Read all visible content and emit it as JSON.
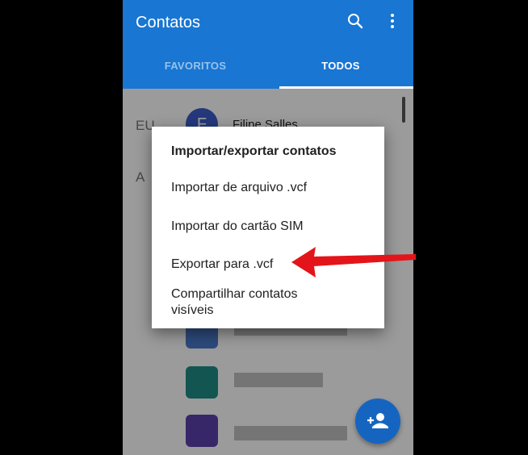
{
  "app": {
    "title": "Contatos",
    "tabs": [
      {
        "label": "FAVORITOS"
      },
      {
        "label": "TODOS"
      }
    ]
  },
  "contacts": {
    "sections": [
      {
        "letter": "EU"
      },
      {
        "letter": "A"
      }
    ],
    "me": {
      "initial": "F",
      "name": "Filipe Salles"
    }
  },
  "dialog": {
    "title": "Importar/exportar contatos",
    "items": [
      {
        "label": "Importar de arquivo .vcf"
      },
      {
        "label": "Importar do cartão SIM"
      },
      {
        "label": "Exportar para .vcf"
      },
      {
        "label": "Compartilhar contatos visíveis"
      }
    ]
  },
  "icons": {
    "search": "search-icon",
    "more": "more-vert-icon",
    "add_contact": "person-add-icon",
    "annotation": "arrow-left-icon"
  },
  "colors": {
    "primary": "#1976d2",
    "fab": "#1565c0",
    "arrow": "#e3151a"
  }
}
